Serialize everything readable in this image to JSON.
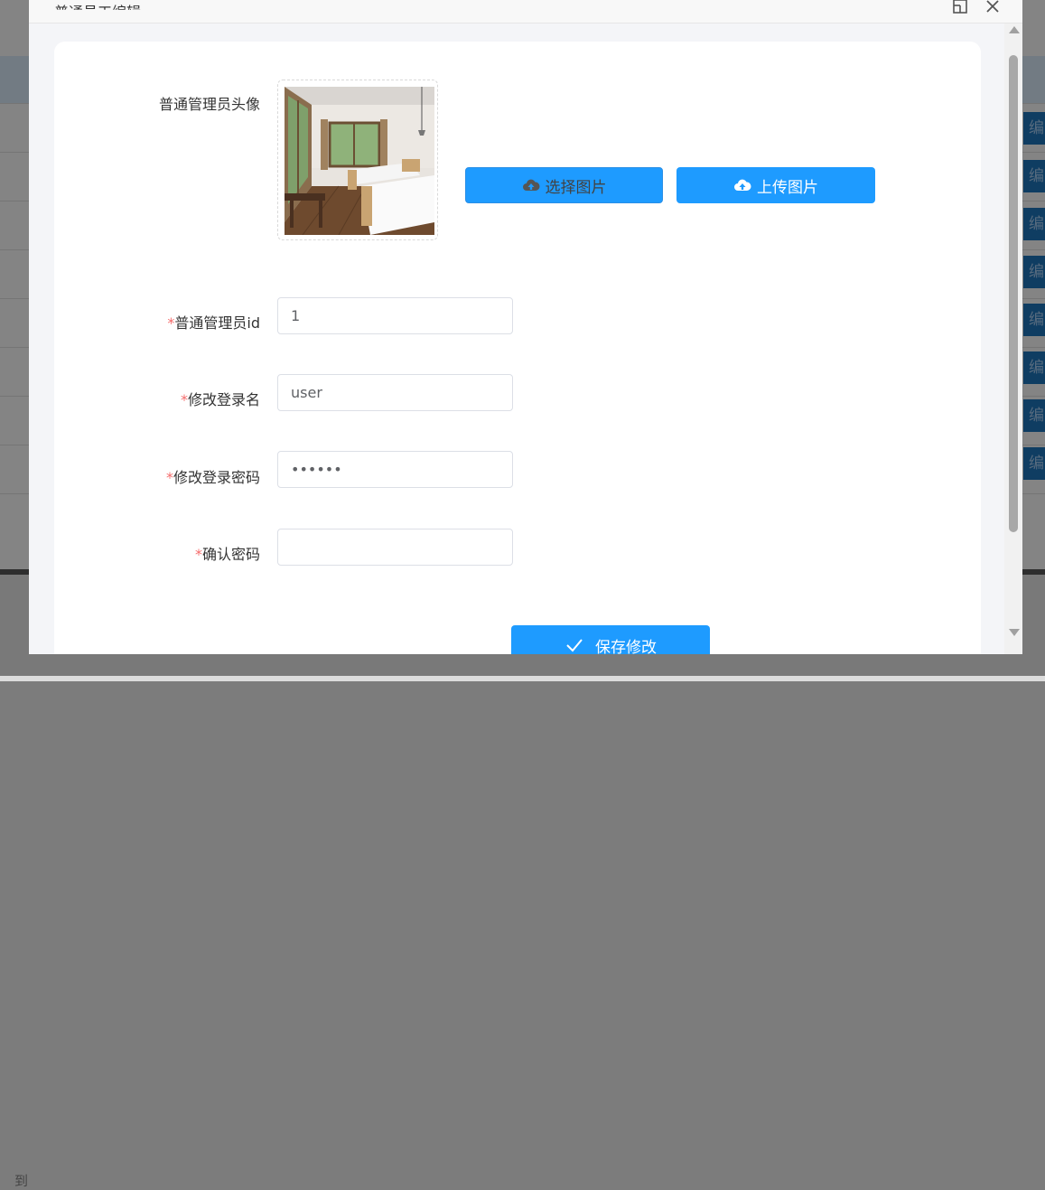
{
  "background": {
    "edit_label": "编",
    "footer_text": "到"
  },
  "dialog": {
    "title": "普通员工编辑",
    "maximize_icon": "maximize-icon",
    "close_icon": "close-icon"
  },
  "form": {
    "avatar_label": "普通管理员头像",
    "select_button": "选择图片",
    "upload_button": "上传图片",
    "id_label": "普通管理员id",
    "id_value": "1",
    "login_label": "修改登录名",
    "login_value": "user",
    "password_label": "修改登录密码",
    "password_value": "123456",
    "confirm_label": "确认密码",
    "confirm_value": "",
    "required_mark": "*",
    "save_button": "保存修改"
  },
  "colors": {
    "primary": "#1e9bff",
    "required": "#f56c6c",
    "edit_button": "#1d6fb3"
  }
}
